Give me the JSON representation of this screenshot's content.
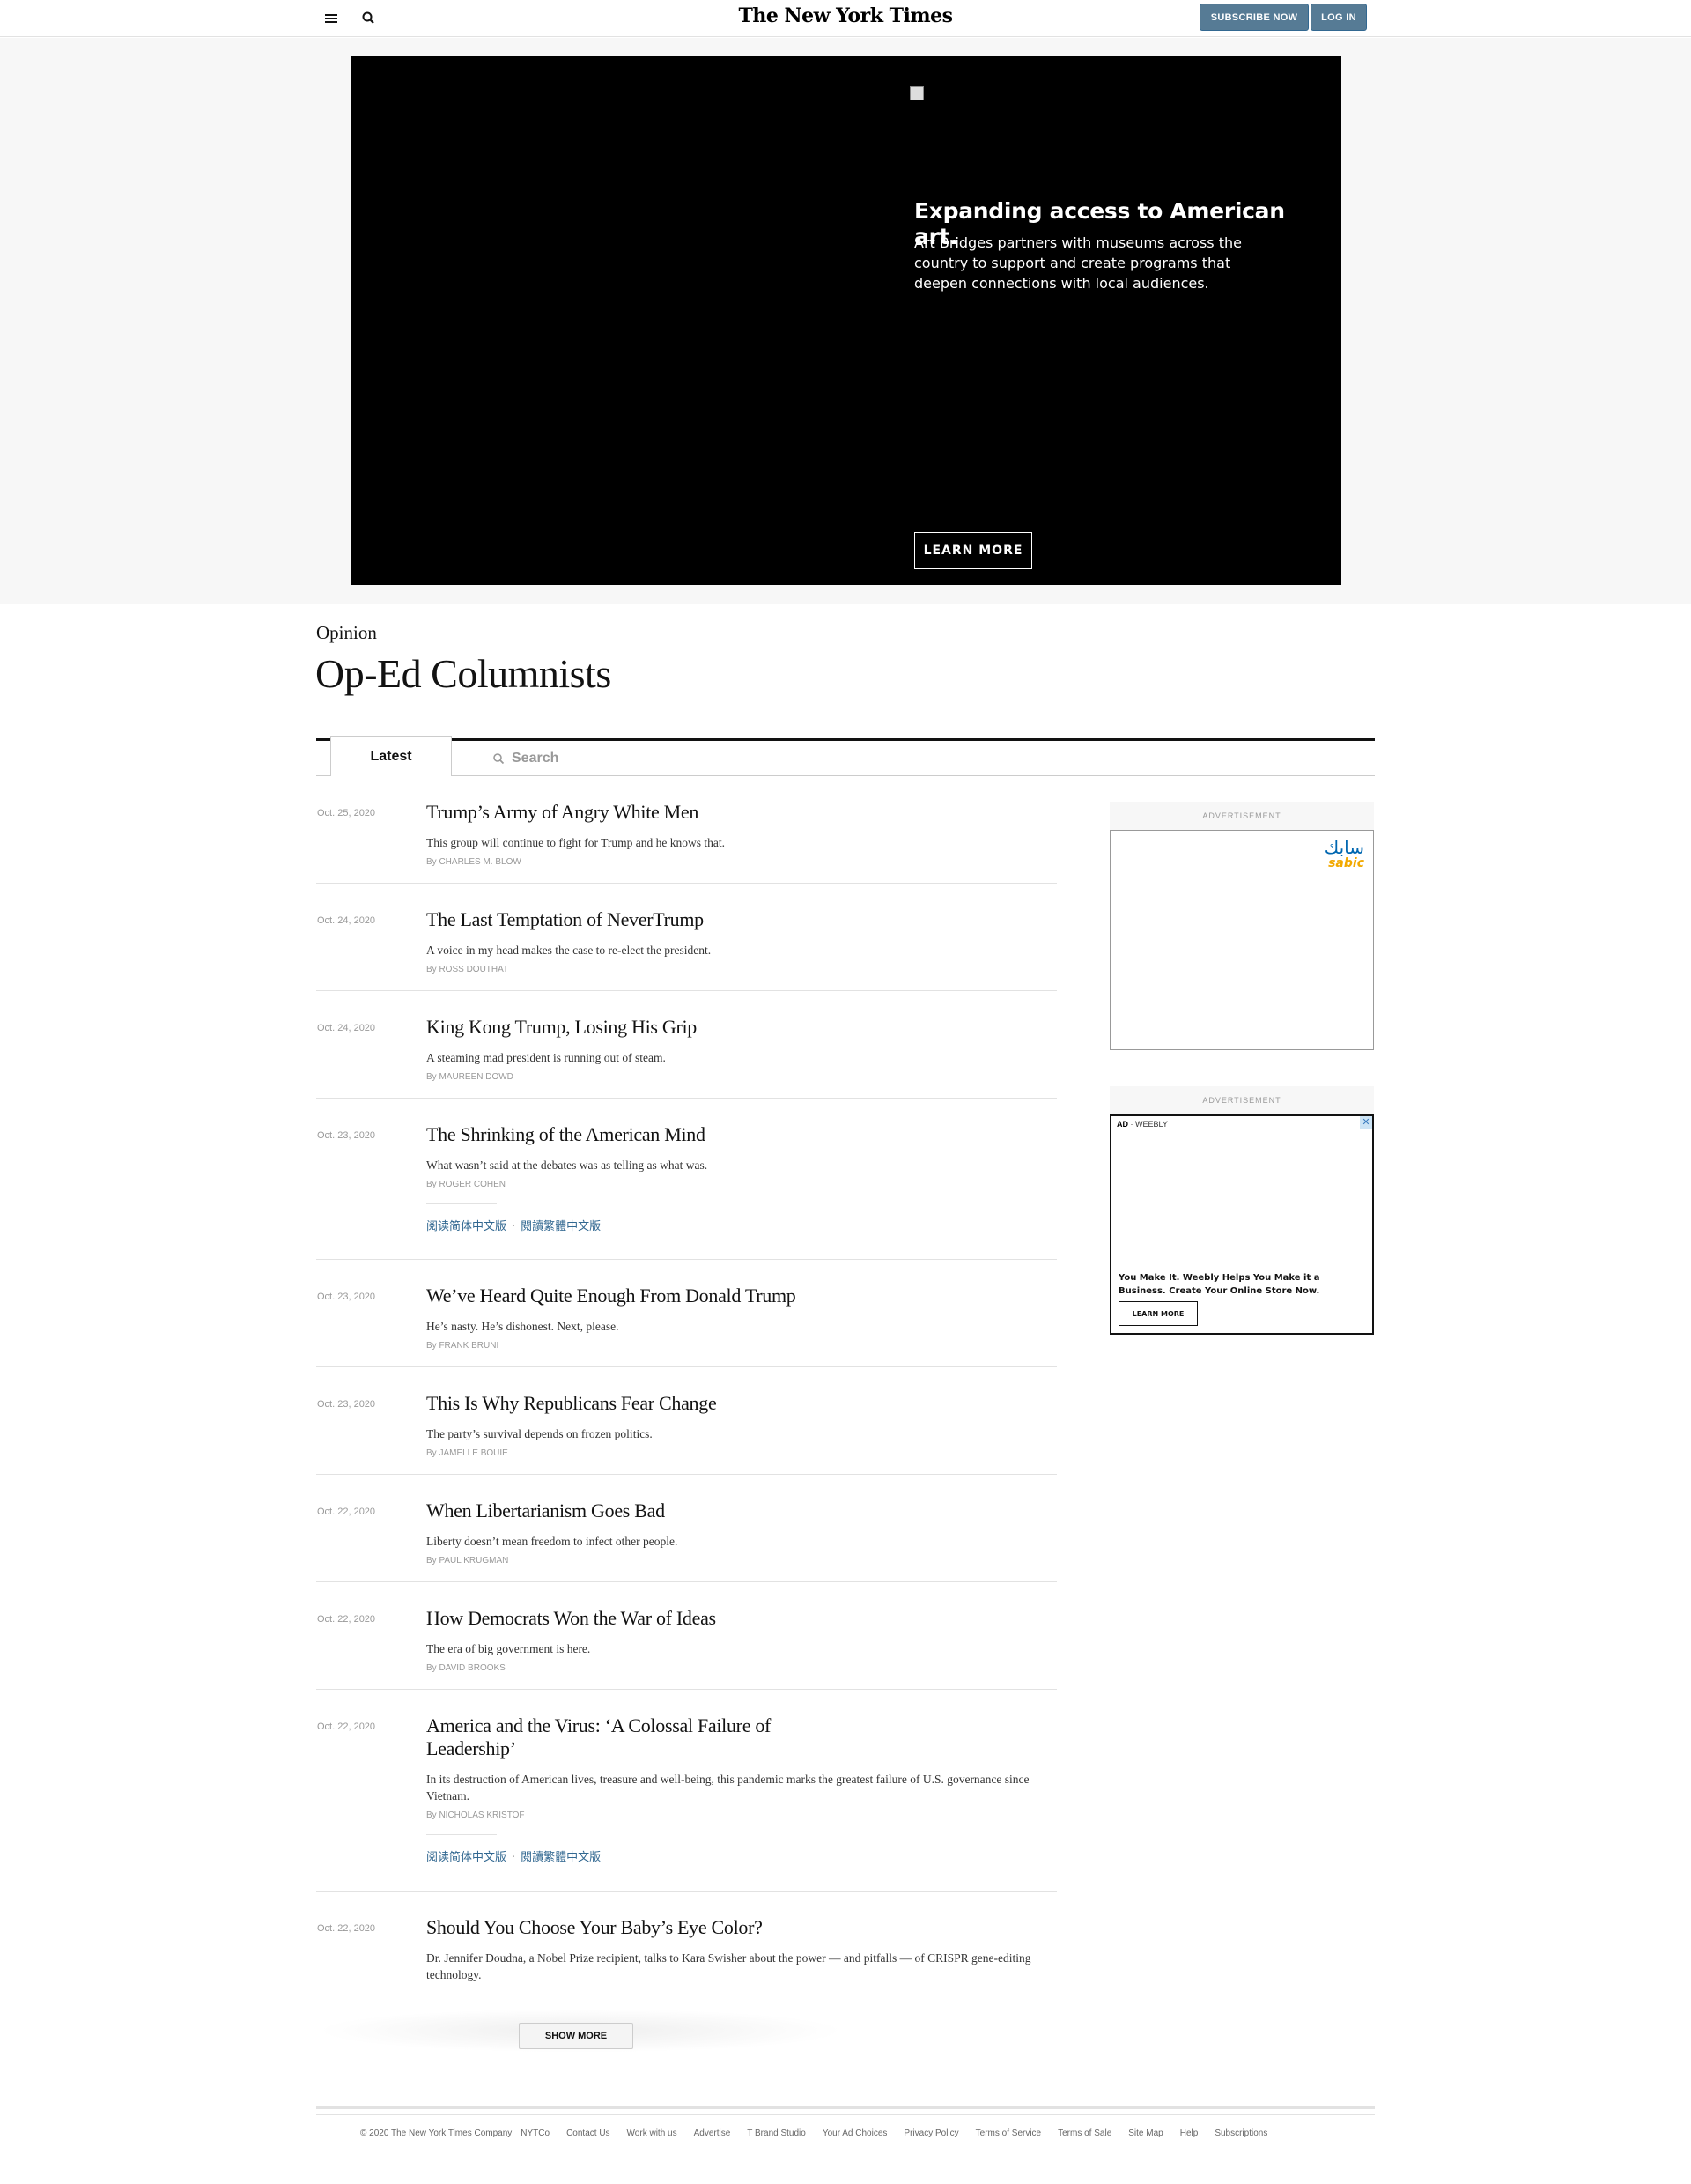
{
  "header": {
    "logo": "The New York Times",
    "subscribe_label": "SUBSCRIBE NOW",
    "login_label": "LOG IN"
  },
  "hero_ad": {
    "headline": "Expanding access to American art.",
    "body": "Art Bridges partners with museums across the country to support and create programs that deepen connections with local audiences.",
    "cta": "LEARN MORE"
  },
  "page": {
    "kicker": "Opinion",
    "title": "Op-Ed Columnists"
  },
  "tabs": {
    "latest_label": "Latest",
    "search_placeholder": "Search"
  },
  "articles": [
    {
      "date": "Oct. 25, 2020",
      "title": "Trump’s Army of Angry White Men",
      "summary": "This group will continue to fight for Trump and he knows that.",
      "by": "By ",
      "author": "CHARLES M. BLOW"
    },
    {
      "date": "Oct. 24, 2020",
      "title": "The Last Temptation of NeverTrump",
      "summary": "A voice in my head makes the case to re-elect the president.",
      "by": "By ",
      "author": "ROSS DOUTHAT"
    },
    {
      "date": "Oct. 24, 2020",
      "title": "King Kong Trump, Losing His Grip",
      "summary": "A steaming mad president is running out of steam.",
      "by": "By ",
      "author": "MAUREEN DOWD"
    },
    {
      "date": "Oct. 23, 2020",
      "title": "The Shrinking of the American Mind",
      "summary": "What wasn’t said at the debates was as telling as what was.",
      "by": "By ",
      "author": "ROGER COHEN",
      "translate_simplified": "阅读简体中文版",
      "translate_traditional": "閱讀繁體中文版",
      "translate_sep": "·"
    },
    {
      "date": "Oct. 23, 2020",
      "title": "We’ve Heard Quite Enough From Donald Trump",
      "summary": "He’s nasty. He’s dishonest. Next, please.",
      "by": "By ",
      "author": "FRANK BRUNI"
    },
    {
      "date": "Oct. 23, 2020",
      "title": "This Is Why Republicans Fear Change",
      "summary": "The party’s survival depends on frozen politics.",
      "by": "By ",
      "author": "JAMELLE BOUIE"
    },
    {
      "date": "Oct. 22, 2020",
      "title": "When Libertarianism Goes Bad",
      "summary": "Liberty doesn’t mean freedom to infect other people.",
      "by": "By ",
      "author": "PAUL KRUGMAN"
    },
    {
      "date": "Oct. 22, 2020",
      "title": "How Democrats Won the War of Ideas",
      "summary": "The era of big government is here.",
      "by": "By ",
      "author": "DAVID BROOKS"
    },
    {
      "date": "Oct. 22, 2020",
      "title": "America and the Virus: ‘A Colossal Failure of Leadership’",
      "summary": "In its destruction of American lives, treasure and well-being, this pandemic marks the greatest failure of U.S. governance since Vietnam.",
      "by": "By ",
      "author": "NICHOLAS KRISTOF",
      "translate_simplified": "阅读简体中文版",
      "translate_traditional": "閱讀繁體中文版",
      "translate_sep": "·"
    },
    {
      "date": "Oct. 22, 2020",
      "title": "Should You Choose Your Baby’s Eye Color?",
      "summary": "Dr. Jennifer Doudna, a Nobel Prize recipient, talks to Kara Swisher about the power — and pitfalls — of CRISPR gene-editing technology."
    }
  ],
  "show_more_label": "SHOW MORE",
  "side_ads": {
    "label": "ADVERTISEMENT",
    "sabic_arabic": "سابك",
    "sabic_latin": "sabic",
    "weebly_chip_ad": "AD",
    "weebly_chip_brand": "WEEBLY",
    "weebly_close": "✕",
    "weebly_text": "You Make It. Weebly Helps You Make it a Business. Create Your Online Store Now.",
    "weebly_cta": "LEARN MORE"
  },
  "footer": {
    "copyright": "© 2020 The New York Times Company",
    "links": [
      "NYTCo",
      "Contact Us",
      "Work with us",
      "Advertise",
      "T Brand Studio",
      "Your Ad Choices",
      "Privacy Policy",
      "Terms of Service",
      "Terms of Sale",
      "Site Map",
      "Help",
      "Subscriptions"
    ]
  },
  "colors": {
    "button_blue": "#567b95",
    "link_blue": "#326891",
    "ad_black": "#000000"
  },
  "icons": [
    "hamburger-menu-icon",
    "search-icon",
    "broken-image-icon",
    "close-icon"
  ]
}
